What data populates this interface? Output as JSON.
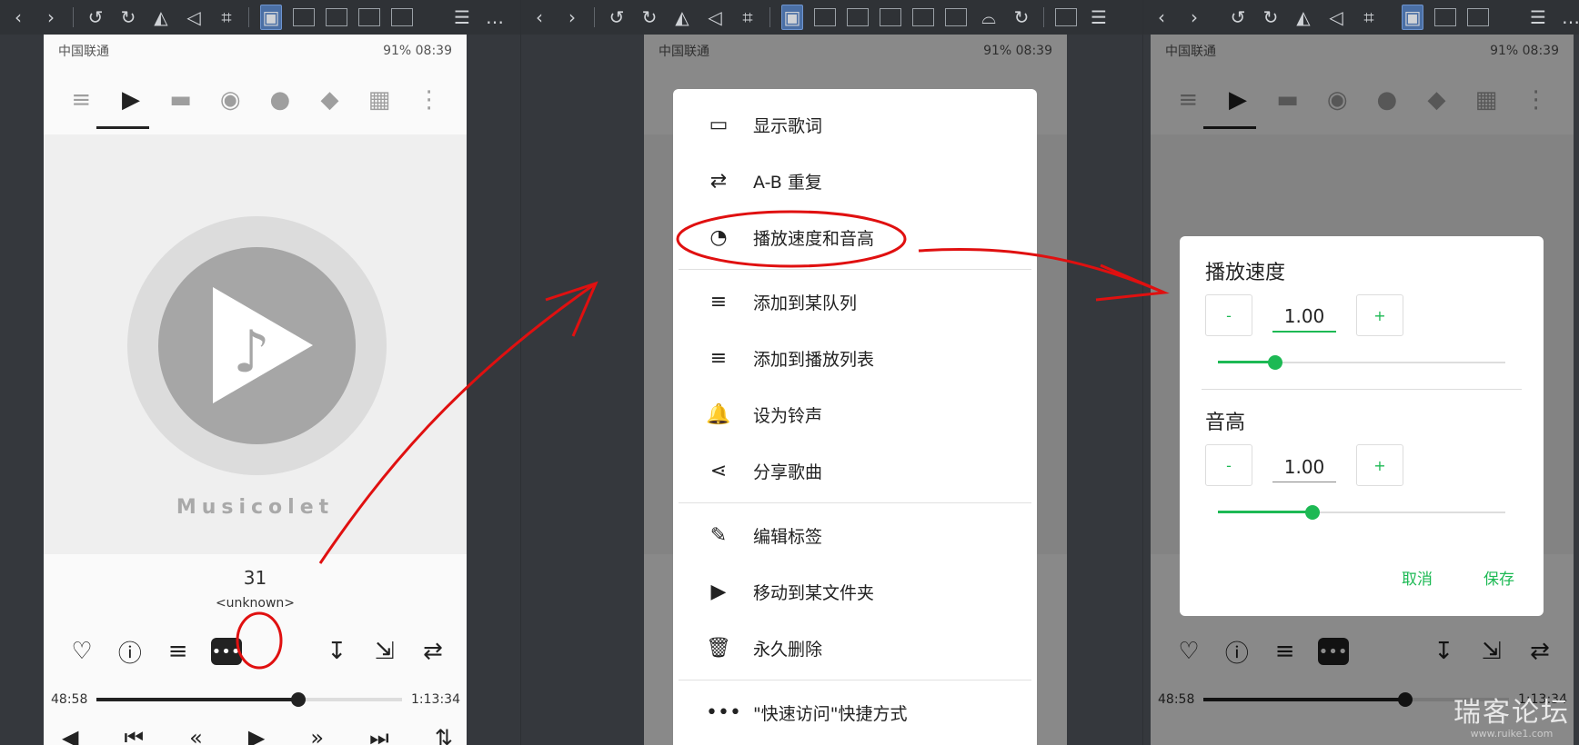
{
  "toolbar_glyphs": {
    "prev": "‹",
    "next": "›",
    "undo": "↺",
    "redo": "↻",
    "flip": "◭",
    "mirror": "◁",
    "crop": "⌗",
    "img": "▣",
    "lock": "🔒",
    "menu": "☰",
    "ellipsis": "…"
  },
  "status": {
    "carrier": "中国联通",
    "battery": "91%",
    "time": "08:39"
  },
  "player": {
    "brand": "Musicolet",
    "title": "31",
    "artist": "<unknown>",
    "elapsed": "48:58",
    "duration": "1:13:34",
    "progress_fraction": 0.66
  },
  "menu": {
    "items": [
      {
        "label": "显示歌词",
        "icon": "subtitles-icon",
        "glyph": "▭"
      },
      {
        "label": "A-B 重复",
        "icon": "ab-repeat-icon",
        "glyph": "⇄"
      },
      {
        "label": "播放速度和音高",
        "icon": "speed-icon",
        "glyph": "◔"
      },
      {
        "label": "添加到某队列",
        "icon": "queue-add-icon",
        "glyph": "≡"
      },
      {
        "label": "添加到播放列表",
        "icon": "playlist-add-icon",
        "glyph": "≡"
      },
      {
        "label": "设为铃声",
        "icon": "bell-icon",
        "glyph": "🔔"
      },
      {
        "label": "分享歌曲",
        "icon": "share-icon",
        "glyph": "⋖"
      },
      {
        "label": "编辑标签",
        "icon": "pencil-icon",
        "glyph": "✎"
      },
      {
        "label": "移动到某文件夹",
        "icon": "folder-move-icon",
        "glyph": "▶"
      },
      {
        "label": "永久删除",
        "icon": "trash-icon",
        "glyph": "🗑"
      },
      {
        "label": "\"快速访问\"快捷方式",
        "icon": "dots-icon",
        "glyph": "•••"
      }
    ]
  },
  "dialog": {
    "speed_title": "播放速度",
    "speed_value": "1.00",
    "speed_level": 0.2,
    "pitch_title": "音高",
    "pitch_value": "1.00",
    "pitch_level": 0.33,
    "minus": "-",
    "plus": "+",
    "cancel": "取消",
    "save": "保存"
  },
  "watermark": {
    "title": "瑞客论坛",
    "url": "www.ruike1.com"
  },
  "colors": {
    "accent": "#1db954",
    "annotation": "#e01010"
  }
}
